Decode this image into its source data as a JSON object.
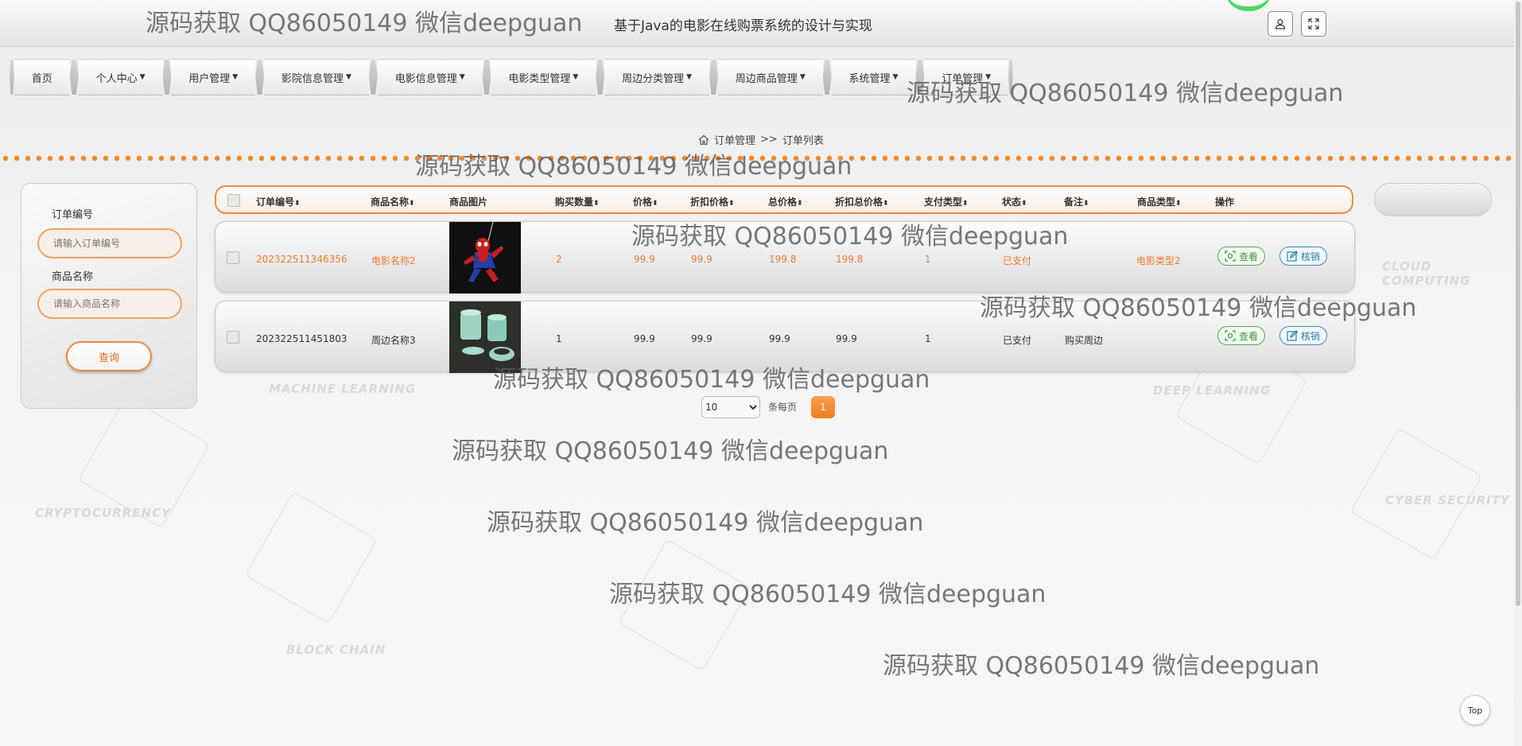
{
  "app": {
    "title": "基于Java的电影在线购票系统的设计与实现"
  },
  "nav": {
    "items": [
      {
        "label": "首页"
      },
      {
        "label": "个人中心"
      },
      {
        "label": "用户管理"
      },
      {
        "label": "影院信息管理"
      },
      {
        "label": "电影信息管理"
      },
      {
        "label": "电影类型管理"
      },
      {
        "label": "周边分类管理"
      },
      {
        "label": "周边商品管理"
      },
      {
        "label": "系统管理"
      },
      {
        "label": "订单管理"
      }
    ]
  },
  "breadcrumb": {
    "section": "订单管理",
    "separator": ">>",
    "page": "订单列表"
  },
  "search": {
    "order_no_label": "订单编号",
    "order_no_placeholder": "请输入订单编号",
    "product_name_label": "商品名称",
    "product_name_placeholder": "请输入商品名称",
    "submit_label": "查询"
  },
  "table": {
    "columns": [
      "订单编号",
      "商品名称",
      "商品图片",
      "购买数量",
      "价格",
      "折扣价格",
      "总价格",
      "折扣总价格",
      "支付类型",
      "状态",
      "备注",
      "商品类型",
      "操作"
    ],
    "rows": [
      {
        "order_no": "202322511346356",
        "product_name": "电影名称2",
        "image": "spiderman-figure",
        "quantity": "2",
        "price": "99.9",
        "discount_price": "99.9",
        "total_price": "199.8",
        "discount_total": "199.8",
        "pay_type": "1",
        "status": "已支付",
        "remark": "",
        "product_type": "电影类型2",
        "highlight": true
      },
      {
        "order_no": "202322511451803",
        "product_name": "周边名称3",
        "image": "teal-cups",
        "quantity": "1",
        "price": "99.9",
        "discount_price": "99.9",
        "total_price": "99.9",
        "discount_total": "99.9",
        "pay_type": "1",
        "status": "已支付",
        "remark": "购买周边",
        "product_type": "",
        "highlight": false
      }
    ],
    "actions": {
      "view_label": "查看",
      "cancel_label": "核销"
    }
  },
  "pagination": {
    "page_size": "10",
    "per_page_label": "条每页",
    "current_page": "1"
  },
  "back_to_top_label": "Top",
  "watermark": "源码获取 QQ86050149 微信deepguan",
  "background_labels": [
    "CLOUD COMPUTING",
    "MACHINE LEARNING",
    "DEEP LEARNING",
    "CRYPTOCURRENCY",
    "CYBER SECURITY",
    "BLOCK CHAIN"
  ],
  "colors": {
    "accent": "#f08a3a",
    "highlight_text": "#f07a2a",
    "view_button": "#4caf50",
    "cancel_button": "#3a8eb0"
  }
}
